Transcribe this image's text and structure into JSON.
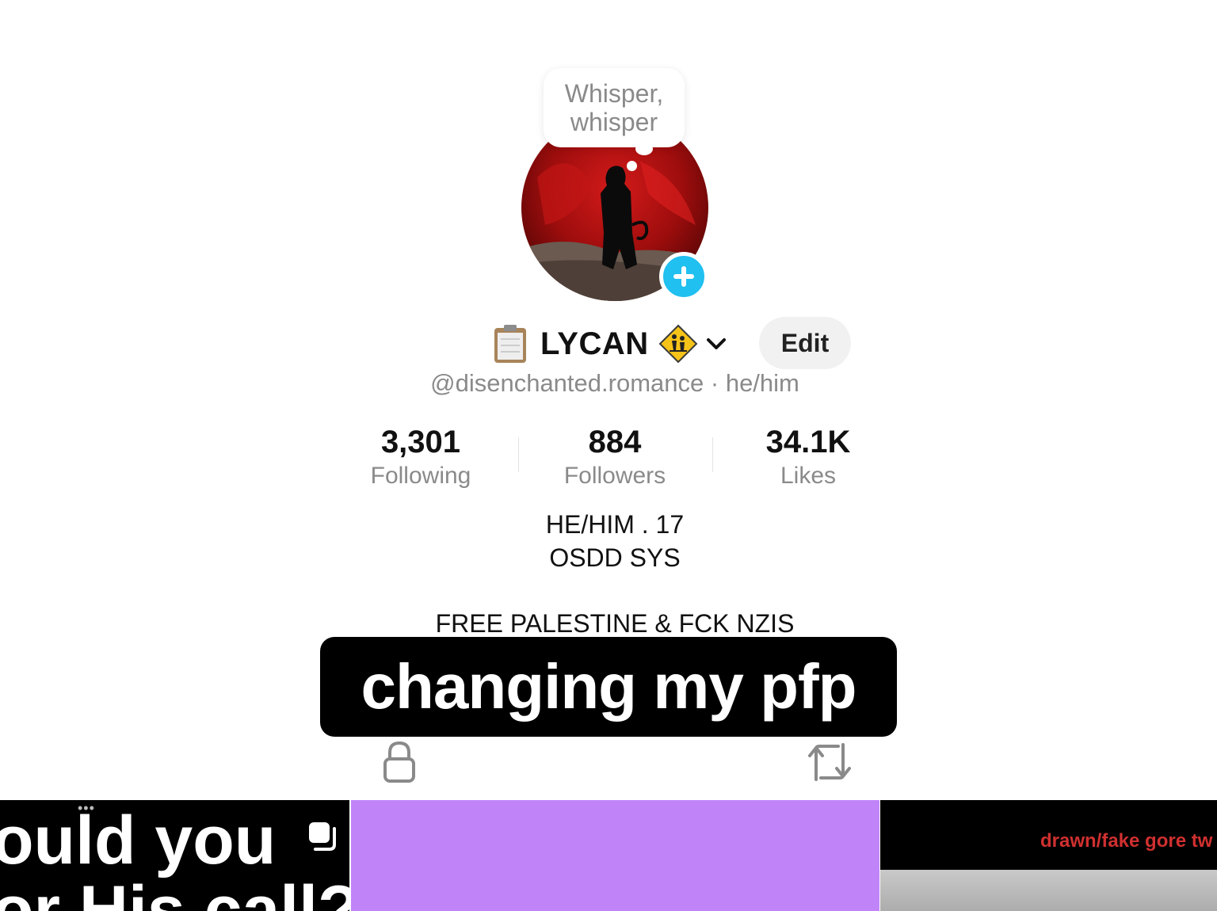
{
  "profile": {
    "thought_bubble": [
      "Whisper,",
      "whisper"
    ],
    "display_name": "LYCAN",
    "edit_label": "Edit",
    "handle": "@disenchanted.romance",
    "pronouns_separator": "·",
    "pronouns": "he/him",
    "stats": [
      {
        "value": "3,301",
        "label": "Following"
      },
      {
        "value": "884",
        "label": "Followers"
      },
      {
        "value": "34.1K",
        "label": "Likes"
      }
    ],
    "bio_lines": [
      "HE/HIM . 17",
      "OSDD SYS",
      "FREE PALESTINE & FCK NZIS"
    ],
    "name_icons": [
      "clipboard-icon",
      "children-crossing-sign-icon",
      "chevron-down-icon"
    ]
  },
  "caption": {
    "text": "changing my pfp"
  },
  "tabs_icons": [
    "lock-icon",
    "repost-icon"
  ],
  "grid": {
    "tiles": [
      {
        "lines": [
          "ould you",
          "or His call?"
        ],
        "dots": "•••"
      },
      {},
      {
        "warning": "drawn/fake gore tw"
      }
    ]
  },
  "colors": {
    "add_button": "#20c0f0",
    "tile_purple": "#c084f8",
    "caption_bg": "#000000",
    "secondary_text": "#8a8a8a",
    "warning_text": "#d03030"
  }
}
